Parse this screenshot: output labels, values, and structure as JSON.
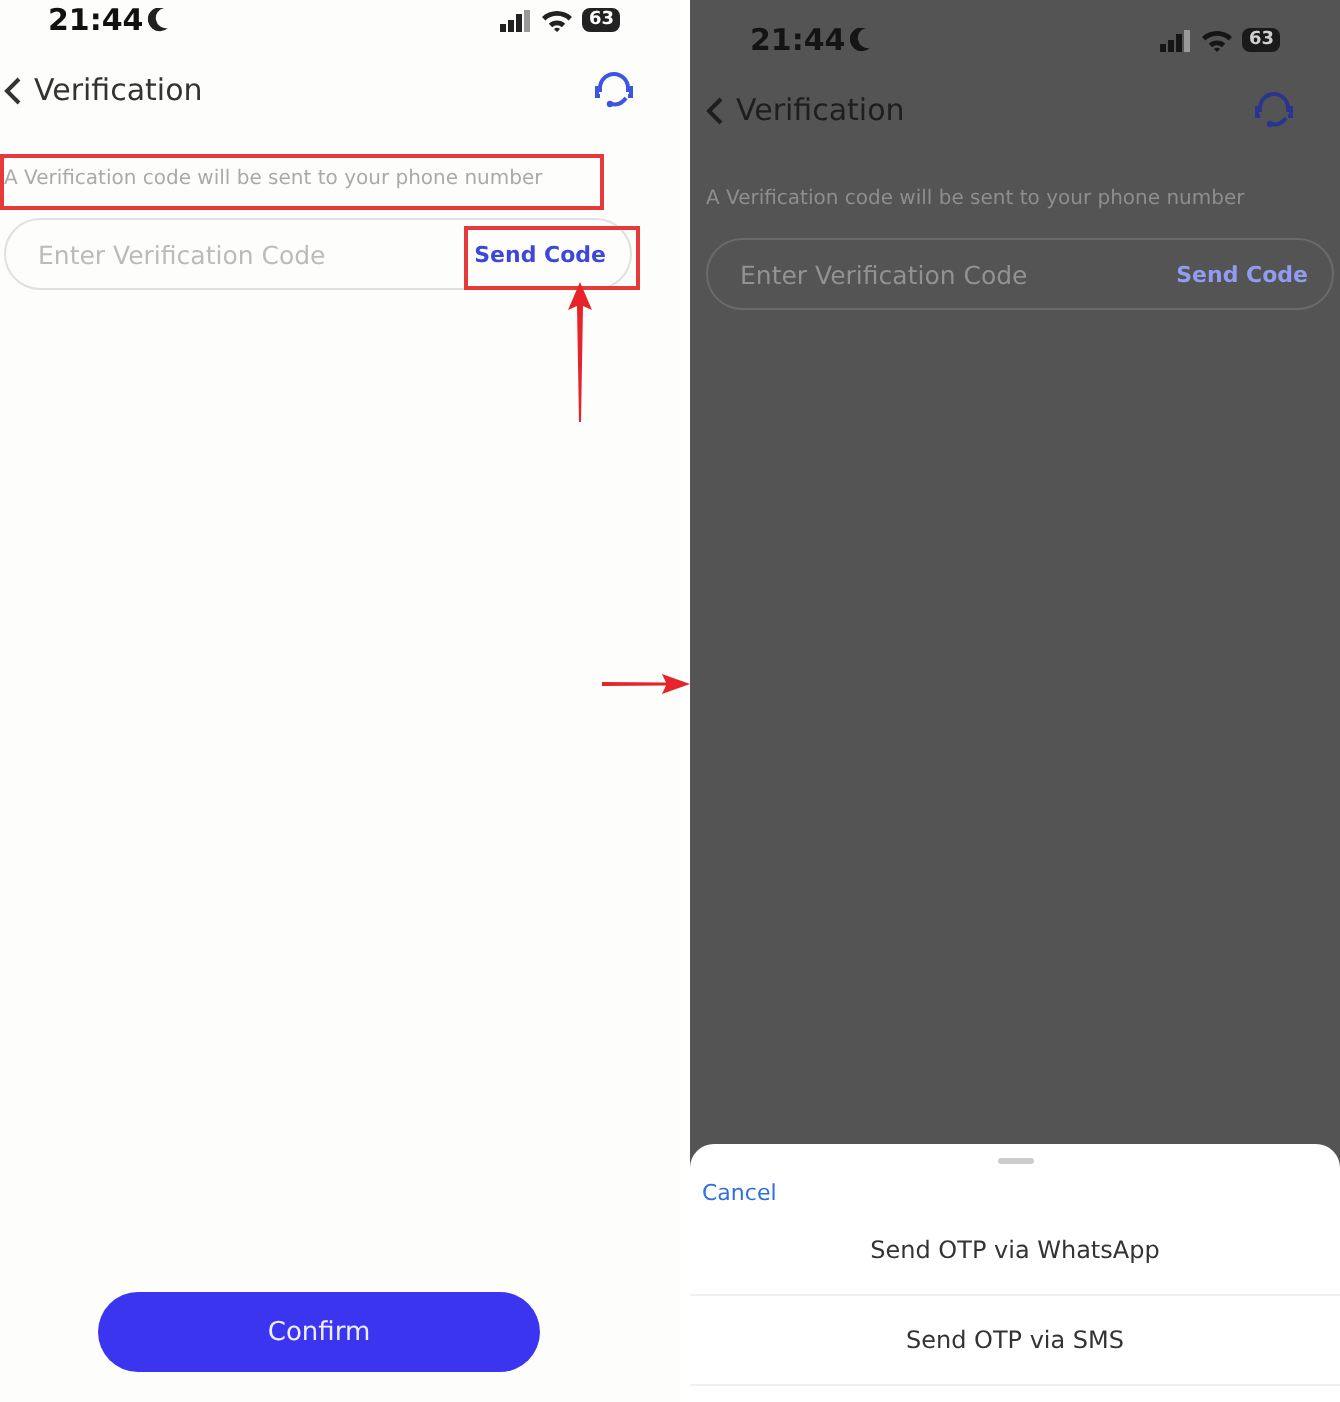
{
  "screens": [
    {
      "status_bar": {
        "time": "21:44",
        "battery": "63"
      },
      "header": {
        "title": "Verification"
      },
      "hint": {
        "text": "A Verification code will be sent to your phone number",
        "highlighted": true
      },
      "code_field": {
        "placeholder": "Enter Verification Code"
      },
      "send_code": {
        "label": "Send Code",
        "highlighted": true
      },
      "confirm": {
        "label": "Confirm"
      },
      "dimmed": false
    },
    {
      "status_bar": {
        "time": "21:44",
        "battery": "63"
      },
      "header": {
        "title": "Verification"
      },
      "hint": {
        "text": "A Verification code will be sent to your phone number",
        "highlighted": false
      },
      "code_field": {
        "placeholder": "Enter Verification Code"
      },
      "send_code": {
        "label": "Send Code",
        "highlighted": false
      },
      "dimmed": true,
      "sheet": {
        "cancel": "Cancel",
        "options": [
          {
            "label": "Send OTP via WhatsApp"
          },
          {
            "label": "Send OTP via SMS"
          }
        ]
      }
    }
  ]
}
